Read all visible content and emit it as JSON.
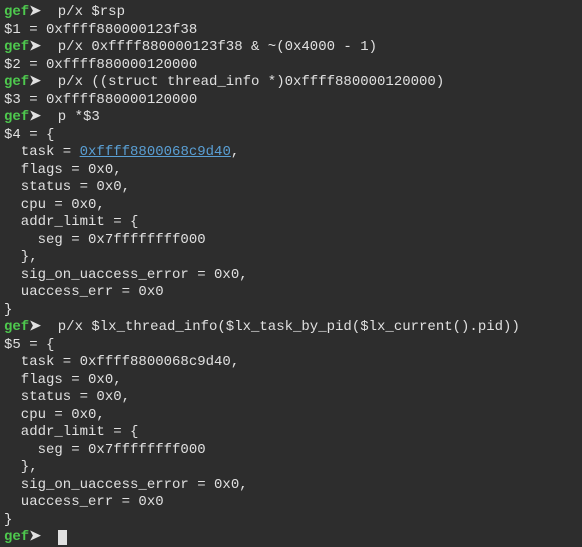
{
  "prompt": {
    "label": "gef",
    "arrow": "➤"
  },
  "entries": [
    {
      "command": "p/x $rsp",
      "outputs": [
        {
          "type": "plain",
          "text": "$1 = 0xffff880000123f38"
        }
      ]
    },
    {
      "command": "p/x 0xffff880000123f38 & ~(0x4000 - 1)",
      "outputs": [
        {
          "type": "plain",
          "text": "$2 = 0xffff880000120000"
        }
      ]
    },
    {
      "command": "p/x ((struct thread_info *)0xffff880000120000)",
      "outputs": [
        {
          "type": "plain",
          "text": "$3 = 0xffff880000120000"
        }
      ]
    },
    {
      "command": "p *$3",
      "outputs": [
        {
          "type": "plain",
          "text": "$4 = {"
        },
        {
          "type": "task",
          "prefix": "  task = ",
          "task_ptr": "0xffff8800068c9d40",
          "suffix": ","
        },
        {
          "type": "plain",
          "text": "  flags = 0x0,"
        },
        {
          "type": "plain",
          "text": "  status = 0x0,"
        },
        {
          "type": "plain",
          "text": "  cpu = 0x0,"
        },
        {
          "type": "plain",
          "text": "  addr_limit = {"
        },
        {
          "type": "plain",
          "text": "    seg = 0x7ffffffff000"
        },
        {
          "type": "plain",
          "text": "  },"
        },
        {
          "type": "plain",
          "text": "  sig_on_uaccess_error = 0x0,"
        },
        {
          "type": "plain",
          "text": "  uaccess_err = 0x0"
        },
        {
          "type": "plain",
          "text": "}"
        }
      ]
    },
    {
      "command": "p/x $lx_thread_info($lx_task_by_pid($lx_current().pid))",
      "outputs": [
        {
          "type": "plain",
          "text": "$5 = {"
        },
        {
          "type": "plain",
          "text": "  task = 0xffff8800068c9d40,"
        },
        {
          "type": "plain",
          "text": "  flags = 0x0,"
        },
        {
          "type": "plain",
          "text": "  status = 0x0,"
        },
        {
          "type": "plain",
          "text": "  cpu = 0x0,"
        },
        {
          "type": "plain",
          "text": "  addr_limit = {"
        },
        {
          "type": "plain",
          "text": "    seg = 0x7ffffffff000"
        },
        {
          "type": "plain",
          "text": "  },"
        },
        {
          "type": "plain",
          "text": "  sig_on_uaccess_error = 0x0,"
        },
        {
          "type": "plain",
          "text": "  uaccess_err = 0x0"
        },
        {
          "type": "plain",
          "text": "}"
        }
      ]
    }
  ]
}
